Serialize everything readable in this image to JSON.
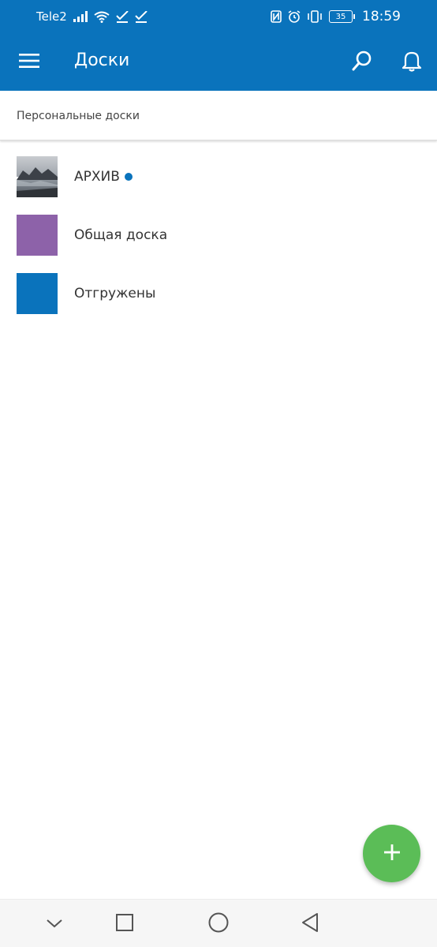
{
  "status_bar": {
    "carrier": "Tele2",
    "battery_level": "35",
    "time": "18:59",
    "icons": [
      "signal-icon",
      "wifi-icon",
      "check-icon",
      "check-icon",
      "nfc-icon",
      "alarm-icon",
      "vibrate-icon",
      "battery-icon"
    ]
  },
  "app_bar": {
    "title": "Доски",
    "icons": [
      "menu-icon",
      "search-icon",
      "bell-icon"
    ],
    "color": "#0a73bc"
  },
  "section": {
    "title": "Персональные доски"
  },
  "boards": [
    {
      "label": "АРХИВ",
      "thumb": "landscape-photo",
      "unread": true
    },
    {
      "label": "Общая доска",
      "thumb_color": "#8d62a9",
      "unread": false
    },
    {
      "label": "Отгружены",
      "thumb_color": "#0a73bc",
      "unread": false
    }
  ],
  "fab": {
    "icon": "plus-icon",
    "color": "#5bbd57"
  },
  "nav_bar": {
    "icons": [
      "chevron-down-icon",
      "square-icon",
      "circle-icon",
      "back-triangle-icon"
    ]
  }
}
